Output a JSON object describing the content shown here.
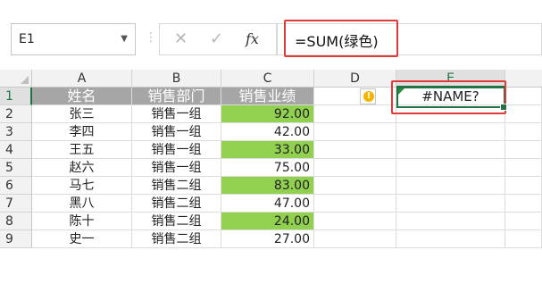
{
  "formula_bar": {
    "name_box": "E1",
    "name_box_dropdown_icon": "chevron-down-icon",
    "separator": "⋮",
    "cancel_icon": "close-icon",
    "confirm_icon": "check-icon",
    "fx_label": "fx",
    "formula": "=SUM(绿色)"
  },
  "columns": [
    "A",
    "B",
    "C",
    "D",
    "E"
  ],
  "selected_column": "E",
  "selected_row": "1",
  "rows": [
    {
      "num": "1",
      "a": "姓名",
      "b": "销售部门",
      "c": "销售业绩",
      "d": "",
      "e": "#NAME?"
    },
    {
      "num": "2",
      "a": "张三",
      "b": "销售一组",
      "c": "92.00",
      "green": true
    },
    {
      "num": "3",
      "a": "李四",
      "b": "销售一组",
      "c": "42.00",
      "green": false
    },
    {
      "num": "4",
      "a": "王五",
      "b": "销售一组",
      "c": "33.00",
      "green": true
    },
    {
      "num": "5",
      "a": "赵六",
      "b": "销售一组",
      "c": "75.00",
      "green": false
    },
    {
      "num": "6",
      "a": "马七",
      "b": "销售二组",
      "c": "83.00",
      "green": true
    },
    {
      "num": "7",
      "a": "黑八",
      "b": "销售二组",
      "c": "47.00",
      "green": false
    },
    {
      "num": "8",
      "a": "陈十",
      "b": "销售二组",
      "c": "24.00",
      "green": true
    },
    {
      "num": "9",
      "a": "史一",
      "b": "销售二组",
      "c": "27.00",
      "green": false
    }
  ],
  "colors": {
    "header_fill": "#a6a6a6",
    "highlight_green": "#92d050",
    "annotation_red": "#e03a3a",
    "selection_green": "#217346"
  },
  "error_indicator_icon": "warning-icon"
}
